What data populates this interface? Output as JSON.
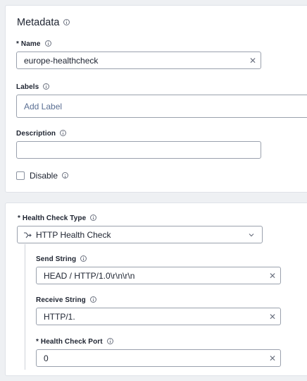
{
  "metadata": {
    "title": "Metadata",
    "name": {
      "label": "* Name",
      "value": "europe-healthcheck"
    },
    "labels": {
      "label": "Labels",
      "placeholder": "Add Label"
    },
    "description": {
      "label": "Description",
      "value": ""
    },
    "disable": {
      "label": "Disable",
      "checked": false
    }
  },
  "health_check": {
    "type_label": "* Health Check Type",
    "type_value": "HTTP Health Check",
    "send_string": {
      "label": "Send String",
      "value": "HEAD / HTTP/1.0\\r\\n\\r\\n"
    },
    "receive_string": {
      "label": "Receive String",
      "value": "HTTP/1."
    },
    "port": {
      "label": "* Health Check Port",
      "value": "0"
    }
  },
  "icons": {
    "info": "info-icon",
    "clear": "close-icon",
    "type": "fork-icon",
    "dropdown": "chevron-down-icon"
  },
  "colors": {
    "background": "#eef0f3",
    "card": "#ffffff",
    "border": "#9aa1ad",
    "placeholder": "#5a6f93"
  }
}
